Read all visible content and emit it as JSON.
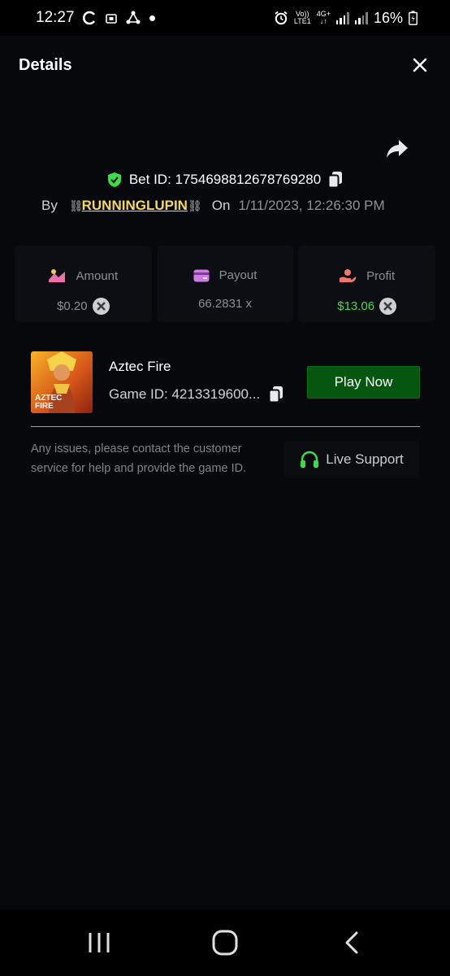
{
  "status_bar": {
    "time": "12:27",
    "net_top": "Vo))",
    "net_bottom": "LTE1",
    "net2_top": "4G+",
    "net2_bottom": "↓↑",
    "battery": "16%"
  },
  "header": {
    "title": "Details"
  },
  "bet": {
    "id_text": "Bet ID: 1754698812678769280",
    "by_label": "By",
    "username": "RUNNINGLUPIN",
    "chain_glyph": "⛓",
    "on_label": "On",
    "datetime": "1/11/2023, 12:26:30 PM"
  },
  "stats": {
    "amount_label": "Amount",
    "amount_value": "$0.20",
    "payout_label": "Payout",
    "payout_value": "66.2831 x",
    "profit_label": "Profit",
    "profit_value": "$13.06"
  },
  "game": {
    "name": "Aztec Fire",
    "thumb_line1": "AZTEC",
    "thumb_line2": "FIRE",
    "id_text": "Game ID: 4213319600...",
    "play_label": "Play Now"
  },
  "support": {
    "help_text": "Any issues, please contact the customer service for help and provide the game ID.",
    "button_label": "Live Support"
  },
  "colors": {
    "accent_green": "#3ddc49",
    "play_button": "#05560f",
    "username": "#f6d85c",
    "shield": "#3ddc49"
  },
  "icons": [
    "shield-check-icon",
    "copy-icon",
    "share-icon",
    "close-icon",
    "amount-icon",
    "payout-card-icon",
    "profit-icon",
    "currency-coin-icon",
    "headset-icon",
    "recents-icon",
    "home-icon",
    "back-icon"
  ]
}
